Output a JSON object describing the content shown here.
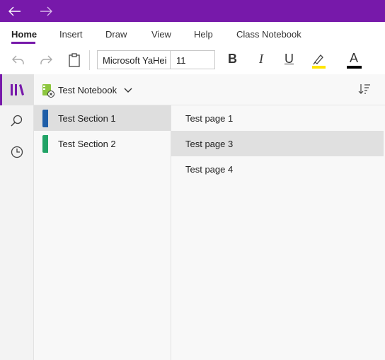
{
  "titlebar": {
    "back_icon": "arrow-left-icon",
    "forward_icon": "arrow-right-icon",
    "color": "#7719aa"
  },
  "tabs": [
    {
      "label": "Home",
      "active": true
    },
    {
      "label": "Insert"
    },
    {
      "label": "Draw"
    },
    {
      "label": "View"
    },
    {
      "label": "Help"
    },
    {
      "label": "Class Notebook"
    }
  ],
  "toolbar": {
    "font_name": "Microsoft YaHei",
    "font_size": "11",
    "bold_label": "B",
    "italic_label": "I",
    "underline_label": "U",
    "font_color_label": "A",
    "highlight_color": "#ffe500",
    "font_color": "#000000"
  },
  "notebook": {
    "title": "Test Notebook"
  },
  "sections": [
    {
      "label": "Test Section 1",
      "color": "#1f5ea8",
      "selected": true
    },
    {
      "label": "Test Section 2",
      "color": "#21a366"
    }
  ],
  "pages": [
    {
      "label": "Test page 1"
    },
    {
      "label": "Test page 3",
      "selected": true
    },
    {
      "label": "Test page 4"
    }
  ]
}
